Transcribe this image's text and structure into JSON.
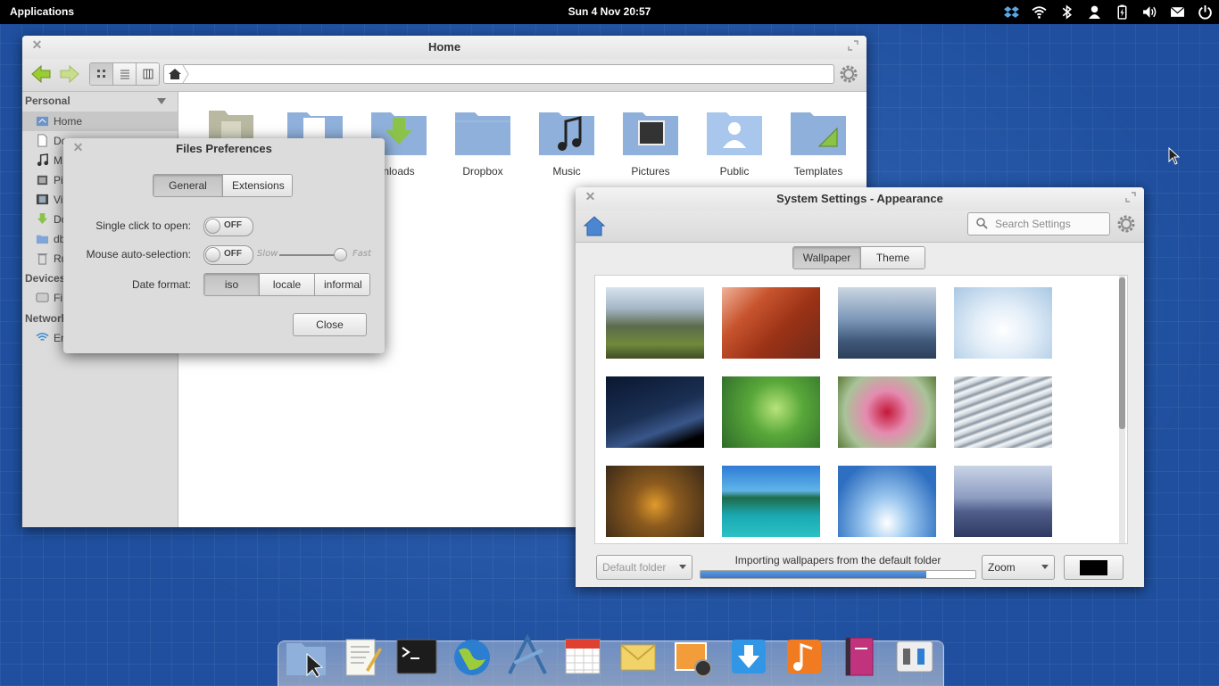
{
  "panel": {
    "applications": "Applications",
    "clock": "Sun  4 Nov 20:57",
    "indicators": [
      "dropbox-icon",
      "wifi-icon",
      "bluetooth-icon",
      "user-icon",
      "battery-icon",
      "volume-icon",
      "mail-icon",
      "power-icon"
    ]
  },
  "files": {
    "title": "Home",
    "sidebar": {
      "personal": "Personal",
      "items": [
        {
          "label": "Home",
          "icon": "home-folder-icon"
        },
        {
          "label": "Do",
          "icon": "documents-icon"
        },
        {
          "label": "M",
          "icon": "music-icon"
        },
        {
          "label": "Pi",
          "icon": "pictures-icon"
        },
        {
          "label": "Vi",
          "icon": "videos-icon"
        },
        {
          "label": "Do",
          "icon": "downloads-icon"
        },
        {
          "label": "db",
          "icon": "folder-icon"
        },
        {
          "label": "Ru",
          "icon": "trash-icon"
        }
      ],
      "devices": "Devices",
      "device_items": [
        {
          "label": "Fi",
          "icon": "filesystem-icon"
        }
      ],
      "network": "Network",
      "network_items": [
        {
          "label": "En",
          "icon": "network-icon"
        }
      ]
    },
    "folders": [
      {
        "label": ""
      },
      {
        "label": ""
      },
      {
        "label": "nloads"
      },
      {
        "label": "Dropbox"
      },
      {
        "label": "Music"
      },
      {
        "label": "Pictures"
      },
      {
        "label": "Public"
      },
      {
        "label": "Templates"
      }
    ]
  },
  "prefs": {
    "title": "Files Preferences",
    "tabs": [
      "General",
      "Extensions"
    ],
    "single_click_label": "Single click to open:",
    "single_click_value": "OFF",
    "auto_select_label": "Mouse auto-selection:",
    "auto_select_value": "OFF",
    "slow": "Slow",
    "fast": "Fast",
    "date_format_label": "Date format:",
    "date_formats": [
      "iso",
      "locale",
      "informal"
    ],
    "close": "Close"
  },
  "settings": {
    "title": "System Settings - Appearance",
    "search_placeholder": "Search Settings",
    "tabs": [
      "Wallpaper",
      "Theme"
    ],
    "folder_combo": "Default folder",
    "progress_label": "Importing wallpapers from the default folder",
    "progress": 0.82,
    "zoom_combo": "Zoom",
    "color": "#000000"
  },
  "dock": [
    "files-icon",
    "text-editor-icon",
    "terminal-icon",
    "browser-icon",
    "mail-client-icon",
    "calendar-icon",
    "postler-icon",
    "shotwell-icon",
    "updates-icon",
    "music-player-icon",
    "contacts-icon",
    "settings-icon"
  ]
}
